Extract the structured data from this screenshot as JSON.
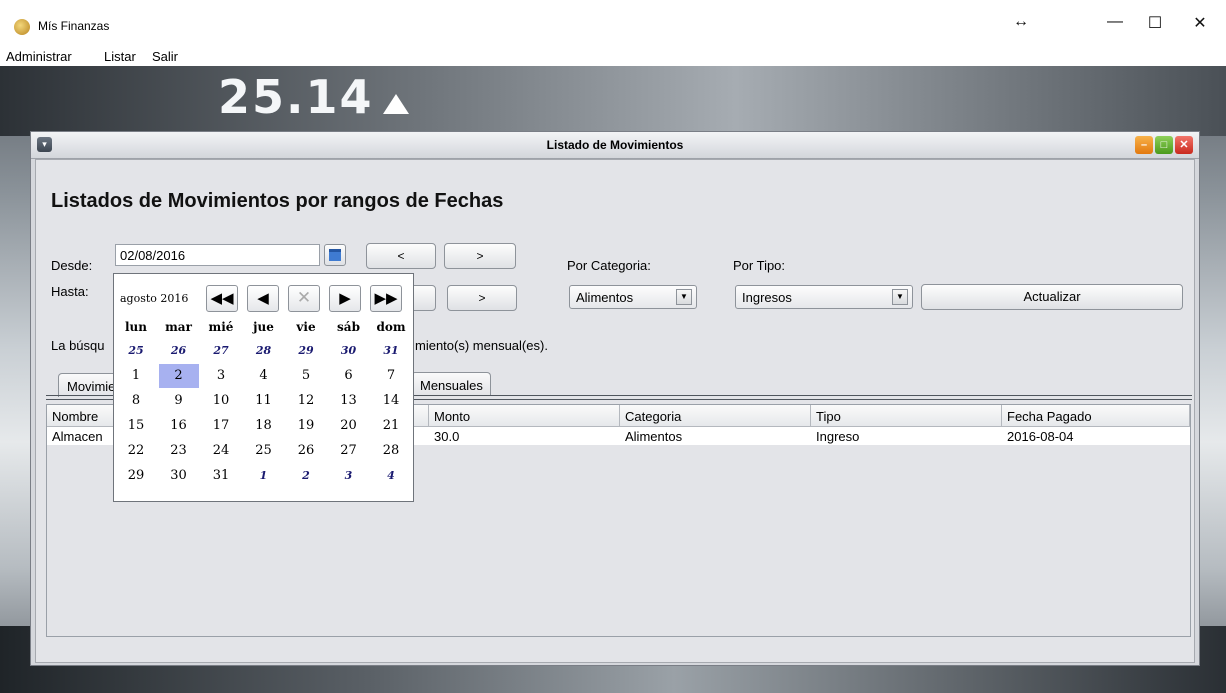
{
  "window": {
    "title": "Mís Finanzas",
    "resize_glyph": "↔",
    "minimize_glyph": "—",
    "maximize_glyph": "☐",
    "close_glyph": "✕"
  },
  "menu": [
    "Administrar",
    "Listar",
    "Salir"
  ],
  "desktop": {
    "clock_text": "25.14"
  },
  "frame": {
    "title": "Listado de Movimientos",
    "heading": "Listados de Movimientos por rangos de Fechas",
    "desde_label": "Desde:",
    "hasta_label": "Hasta:",
    "desde_value": "02/08/2016",
    "prev_label": "<",
    "next_label": ">",
    "categoria_label": "Por Categoria:",
    "categoria_value": "Alimentos",
    "tipo_label": "Por Tipo:",
    "tipo_value": "Ingresos",
    "actualizar_label": "Actualizar",
    "result_left": "La búsqu",
    "result_right": "miento(s) mensual(es).",
    "tab_left": "Movimie",
    "tab_right": "Mensuales",
    "columns": {
      "nombre": "Nombre",
      "monto": "Monto",
      "categoria": "Categoria",
      "tipo": "Tipo",
      "fecha": "Fecha Pagado"
    },
    "row": {
      "nombre": "Almacen",
      "monto": "30.0",
      "categoria": "Alimentos",
      "tipo": "Ingreso",
      "fecha": "2016-08-04"
    }
  },
  "calendar": {
    "month_label": "agosto 2016",
    "nav": {
      "prev_year": "◀◀",
      "prev_month": "◀",
      "clear": "✕",
      "next_month": "▶",
      "next_year": "▶▶"
    },
    "weekdays": [
      "lun",
      "mar",
      "mié",
      "jue",
      "vie",
      "sáb",
      "dom"
    ],
    "weeks": [
      [
        "25",
        "26",
        "27",
        "28",
        "29",
        "30",
        "31"
      ],
      [
        "1",
        "2",
        "3",
        "4",
        "5",
        "6",
        "7"
      ],
      [
        "8",
        "9",
        "10",
        "11",
        "12",
        "13",
        "14"
      ],
      [
        "15",
        "16",
        "17",
        "18",
        "19",
        "20",
        "21"
      ],
      [
        "22",
        "23",
        "24",
        "25",
        "26",
        "27",
        "28"
      ],
      [
        "29",
        "30",
        "31",
        "1",
        "2",
        "3",
        "4"
      ]
    ],
    "selected_day": "2",
    "highlight_color": "#a7b1f0"
  }
}
